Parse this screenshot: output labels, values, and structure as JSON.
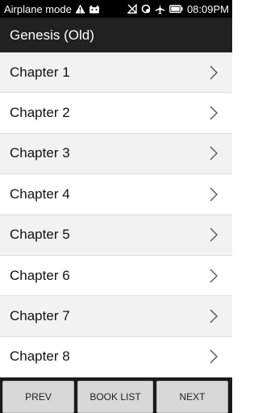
{
  "status_bar": {
    "mode_text": "Airplane mode",
    "time": "08:09PM",
    "icons": [
      "warning-icon",
      "cat-icon",
      "no-signal-icon",
      "sync-icon",
      "airplane-icon",
      "battery-icon"
    ]
  },
  "app_bar": {
    "title": "Genesis (Old)"
  },
  "chapters": [
    {
      "label": "Chapter 1"
    },
    {
      "label": "Chapter 2"
    },
    {
      "label": "Chapter 3"
    },
    {
      "label": "Chapter 4"
    },
    {
      "label": "Chapter 5"
    },
    {
      "label": "Chapter 6"
    },
    {
      "label": "Chapter 7"
    },
    {
      "label": "Chapter 8"
    }
  ],
  "bottom_bar": {
    "prev_label": "PREV",
    "book_list_label": "BOOK LIST",
    "next_label": "NEXT"
  },
  "colors": {
    "status_bar": "#000000",
    "app_bar": "#212121",
    "row_alt": "#f2f2f2",
    "button_bg": "#d8d8d8"
  }
}
